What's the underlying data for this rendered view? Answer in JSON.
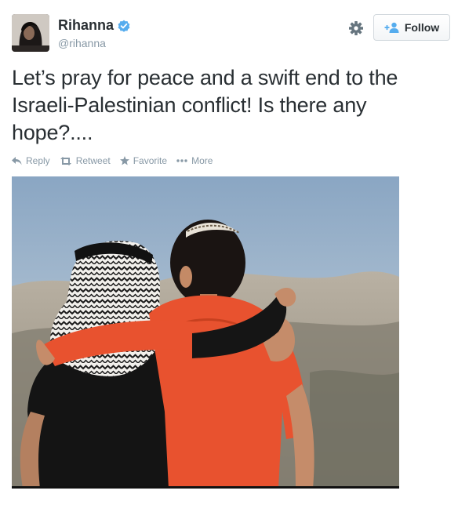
{
  "user": {
    "name": "Rihanna",
    "handle": "@rihanna",
    "verified": true
  },
  "header": {
    "follow_label": "Follow",
    "settings_icon": "gear-icon"
  },
  "tweet": {
    "text": "Let’s pray for peace and a swift end to the Israeli-Palestinian conflict! Is there any hope?...."
  },
  "actions": [
    {
      "icon": "reply-icon",
      "label": "Reply"
    },
    {
      "icon": "retweet-icon",
      "label": "Retweet"
    },
    {
      "icon": "star-icon",
      "label": "Favorite"
    },
    {
      "icon": "more-icon",
      "label": "More"
    }
  ],
  "colors": {
    "text": "#292f33",
    "muted": "#8899a6",
    "verified": "#55acee",
    "follow_icon": "#55acee",
    "shirt": "#e8522f"
  }
}
